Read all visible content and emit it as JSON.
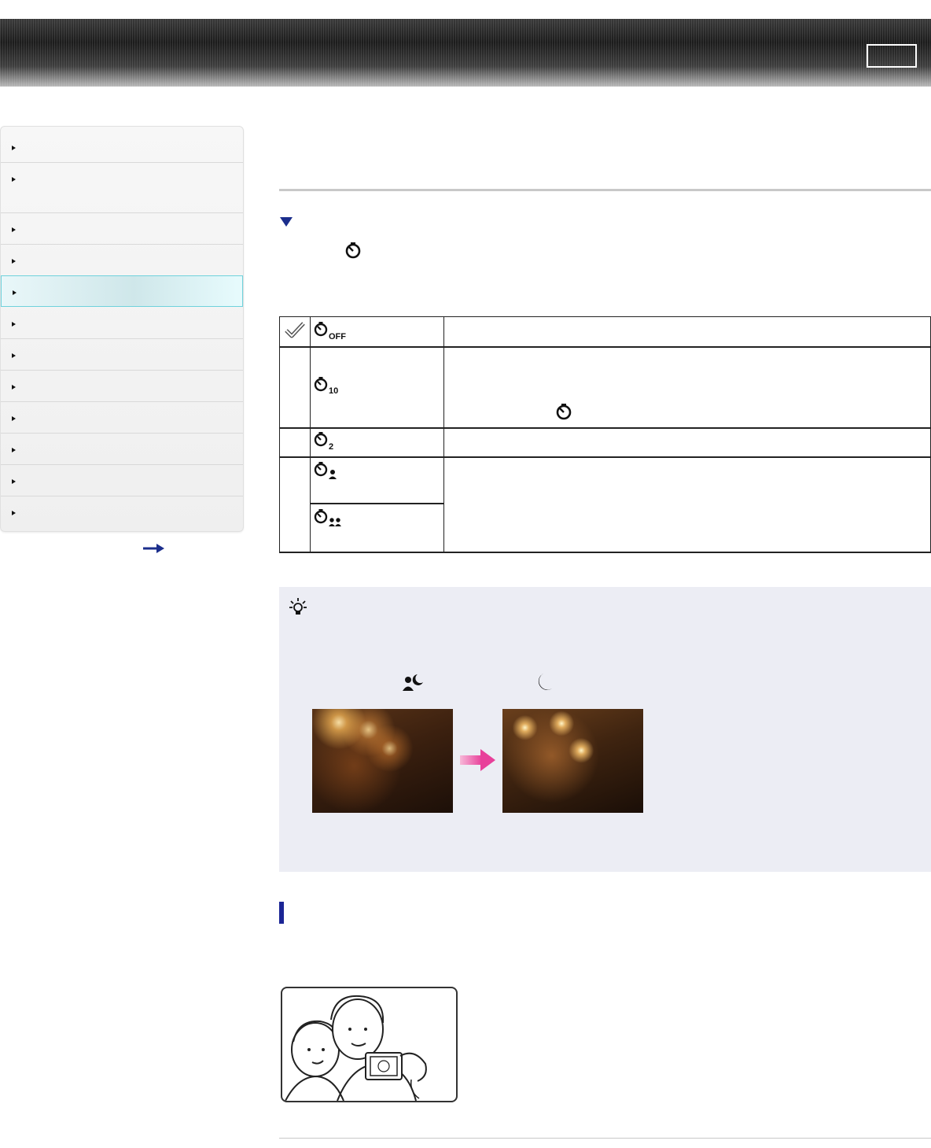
{
  "header": {
    "box_label": ""
  },
  "sidebar": {
    "items": [
      {
        "label": ""
      },
      {
        "label": ""
      },
      {
        "label": ""
      },
      {
        "label": ""
      },
      {
        "label": "",
        "active": true
      },
      {
        "label": ""
      },
      {
        "label": ""
      },
      {
        "label": ""
      },
      {
        "label": ""
      },
      {
        "label": ""
      },
      {
        "label": ""
      },
      {
        "label": ""
      }
    ],
    "more_icon": "right-arrow-icon"
  },
  "main": {
    "section_icon": "self-timer-icon",
    "table": {
      "rows": [
        {
          "check": "checkmark-icon",
          "icon": "self-timer-off-icon",
          "description": ""
        },
        {
          "check": "",
          "icon": "self-timer-10sec-icon",
          "description": "",
          "inline_icon": "self-timer-icon"
        },
        {
          "check": "",
          "icon": "self-timer-2sec-icon",
          "description": ""
        },
        {
          "check": "",
          "icon": "self-portrait-one-person-icon",
          "description": ""
        },
        {
          "check": "",
          "icon": "self-portrait-two-people-icon",
          "description": ""
        }
      ]
    },
    "hint": {
      "icon": "lightbulb-hint-icon",
      "scene_icons": [
        "night-portrait-icon",
        "night-scene-icon"
      ],
      "arrow_color": "#e8409a"
    }
  },
  "colors": {
    "accent_blue": "#1b2e8c",
    "active_nav": "#6fd2dc",
    "hint_bg": "#ecedf4"
  }
}
